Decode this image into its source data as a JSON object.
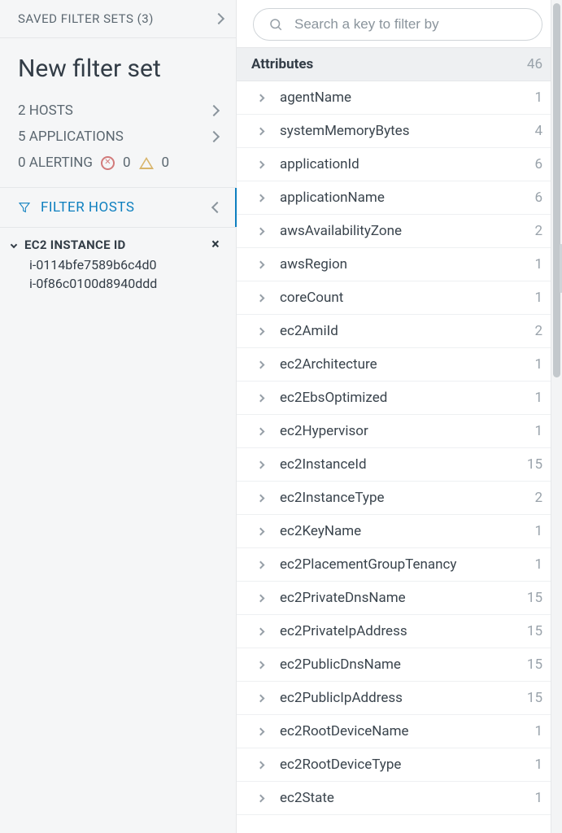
{
  "saved_sets": {
    "label": "SAVED FILTER SETS (3)"
  },
  "filter_set": {
    "title": "New filter set",
    "hosts_label": "2 HOSTS",
    "apps_label": "5 APPLICATIONS",
    "alerting_label": "0 ALERTING",
    "err_count": "0",
    "warn_count": "0"
  },
  "filter_hosts": {
    "label": "FILTER HOSTS"
  },
  "filter_group": {
    "title": "EC2 INSTANCE ID",
    "values": [
      "i-0114bfe7589b6c4d0",
      "i-0f86c0100d8940ddd"
    ]
  },
  "search": {
    "placeholder": "Search a key to filter by"
  },
  "section": {
    "title": "Attributes",
    "count": "46"
  },
  "attributes": [
    {
      "label": "agentName",
      "count": "1"
    },
    {
      "label": "systemMemoryBytes",
      "count": "4"
    },
    {
      "label": "applicationId",
      "count": "6"
    },
    {
      "label": "applicationName",
      "count": "6"
    },
    {
      "label": "awsAvailabilityZone",
      "count": "2"
    },
    {
      "label": "awsRegion",
      "count": "1"
    },
    {
      "label": "coreCount",
      "count": "1"
    },
    {
      "label": "ec2AmiId",
      "count": "2"
    },
    {
      "label": "ec2Architecture",
      "count": "1"
    },
    {
      "label": "ec2EbsOptimized",
      "count": "1"
    },
    {
      "label": "ec2Hypervisor",
      "count": "1"
    },
    {
      "label": "ec2InstanceId",
      "count": "15"
    },
    {
      "label": "ec2InstanceType",
      "count": "2"
    },
    {
      "label": "ec2KeyName",
      "count": "1"
    },
    {
      "label": "ec2PlacementGroupTenancy",
      "count": "1"
    },
    {
      "label": "ec2PrivateDnsName",
      "count": "15"
    },
    {
      "label": "ec2PrivateIpAddress",
      "count": "15"
    },
    {
      "label": "ec2PublicDnsName",
      "count": "15"
    },
    {
      "label": "ec2PublicIpAddress",
      "count": "15"
    },
    {
      "label": "ec2RootDeviceName",
      "count": "1"
    },
    {
      "label": "ec2RootDeviceType",
      "count": "1"
    },
    {
      "label": "ec2State",
      "count": "1"
    }
  ]
}
